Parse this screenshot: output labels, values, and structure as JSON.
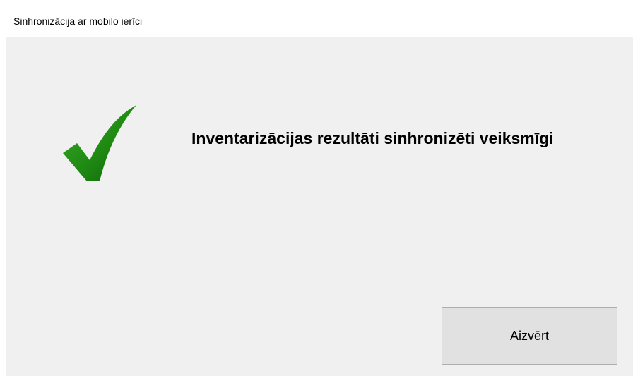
{
  "window": {
    "title": "Sinhronizācija ar mobilo ierīci"
  },
  "dialog": {
    "icon": "checkmark-icon",
    "icon_color": "#1f8a12",
    "message": "Inventarizācijas rezultāti sinhronizēti veiksmīgi",
    "close_label": "Aizvērt"
  }
}
